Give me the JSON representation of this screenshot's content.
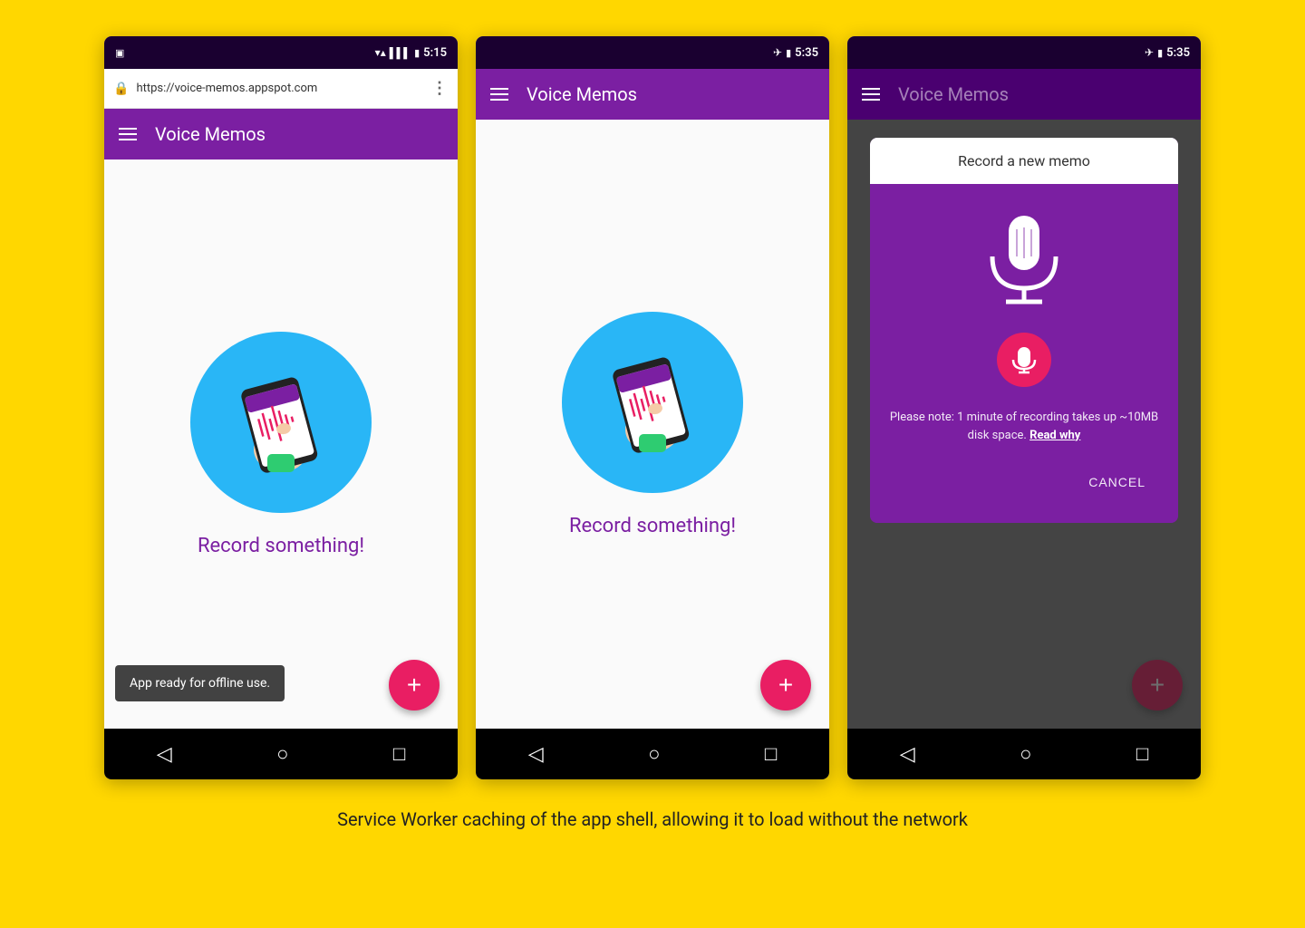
{
  "page": {
    "background_color": "#FFD700",
    "caption": "Service Worker caching of the app shell, allowing it to load without the network"
  },
  "phone1": {
    "status_bar": {
      "time": "5:15",
      "has_signal": true,
      "has_battery": true
    },
    "url_bar": {
      "url": "https://voice-memos.appspot.com",
      "secure": true
    },
    "app_bar": {
      "title": "Voice Memos"
    },
    "main": {
      "record_text": "Record something!"
    },
    "snackbar": {
      "text": "App ready for offline use."
    },
    "fab_label": "+"
  },
  "phone2": {
    "status_bar": {
      "time": "5:35",
      "has_airplane": true,
      "has_battery": true
    },
    "app_bar": {
      "title": "Voice Memos"
    },
    "main": {
      "record_text": "Record something!"
    },
    "fab_label": "+"
  },
  "phone3": {
    "status_bar": {
      "time": "5:35",
      "has_airplane": true,
      "has_battery": true
    },
    "app_bar": {
      "title": "Voice Memos"
    },
    "dialog": {
      "header": "Record a new memo",
      "note_text": "Please note: 1 minute of recording takes up ~10MB disk space.",
      "note_link": "Read why",
      "cancel_label": "CANCEL"
    },
    "fab_label": "+"
  },
  "nav": {
    "back_icon": "◁",
    "home_icon": "○",
    "recents_icon": "□"
  }
}
